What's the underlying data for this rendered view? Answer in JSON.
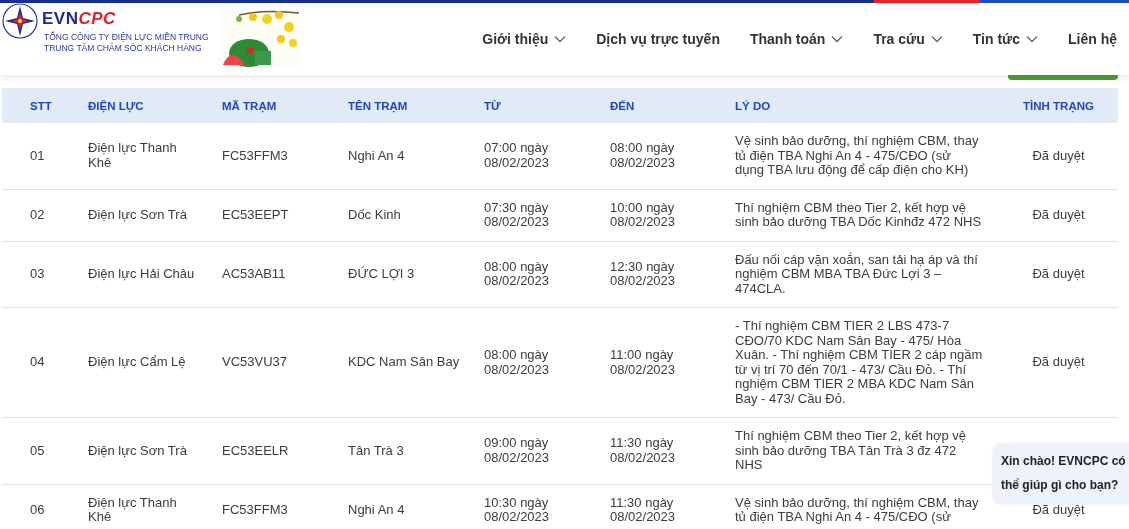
{
  "header": {
    "logo": {
      "brand_primary": "EVN",
      "brand_accent": "CPC",
      "org_lines": [
        "TỔNG CÔNG TY ĐIỆN LỰC MIỀN TRUNG",
        "TRUNG TÂM CHĂM SÓC KHÁCH HÀNG"
      ]
    },
    "nav": [
      {
        "label": "Giới thiệu",
        "has_dropdown": true
      },
      {
        "label": "Dịch vụ trực tuyến",
        "has_dropdown": false
      },
      {
        "label": "Thanh toán",
        "has_dropdown": true
      },
      {
        "label": "Tra cứu",
        "has_dropdown": true
      },
      {
        "label": "Tin tức",
        "has_dropdown": true
      },
      {
        "label": "Liên hệ",
        "has_dropdown": false
      }
    ]
  },
  "table": {
    "columns": [
      "STT",
      "ĐIỆN LỰC",
      "MÃ TRẠM",
      "TÊN TRẠM",
      "TỪ",
      "ĐẾN",
      "LÝ DO",
      "TÌNH TRẠNG"
    ],
    "rows": [
      {
        "stt": "01",
        "unit": "Điện lực Thanh Khê",
        "station_code": "FC53FFM3",
        "station_name": "Nghi An 4",
        "from": "07:00 ngày 08/02/2023",
        "to": "08:00 ngày 08/02/2023",
        "reason": "Vệ sinh bảo dưỡng, thí nghiệm CBM, thay tủ điện TBA Nghi An 4 - 475/CĐO (sử dụng TBA lưu động để cấp điện cho KH)",
        "status": "Đã duyệt"
      },
      {
        "stt": "02",
        "unit": "Điện lực Sơn Trà",
        "station_code": "EC53EEPT",
        "station_name": "Dốc Kinh",
        "from": "07:30 ngày 08/02/2023",
        "to": "10:00 ngày 08/02/2023",
        "reason": "Thí nghiệm CBM theo Tier 2, kết hợp vệ sinh bảo dưỡng TBA Dốc Kinhđz 472 NHS",
        "status": "Đã duyệt"
      },
      {
        "stt": "03",
        "unit": "Điện lực Hải Châu",
        "station_code": "AC53AB11",
        "station_name": "ĐỨC LỢI 3",
        "from": "08:00 ngày 08/02/2023",
        "to": "12:30 ngày 08/02/2023",
        "reason": "Đấu nối cáp vặn xoắn, san tải hạ áp và thí nghiệm CBM MBA TBA Đức Lợi 3 – 474CLA.",
        "status": "Đã duyệt"
      },
      {
        "stt": "04",
        "unit": "Điện lực Cẩm Lệ",
        "station_code": "VC53VU37",
        "station_name": "KDC Nam Sân Bay",
        "from": "08:00 ngày 08/02/2023",
        "to": "11:00 ngày 08/02/2023",
        "reason": "- Thí nghiệm CBM TIER 2 LBS 473-7 CĐO/70 KDC Nam Sân Bay - 475/ Hòa Xuân. - Thí nghiệm CBM TIER 2 cáp ngầm từ vị trí 70 đến 70/1 - 473/ Cầu Đỏ. - Thí nghiệm CBM TIER 2 MBA KDC Nam Sân Bay - 473/ Cầu Đỏ.",
        "status": "Đã duyệt"
      },
      {
        "stt": "05",
        "unit": "Điện lực Sơn Trà",
        "station_code": "EC53EELR",
        "station_name": "Tân Trà 3",
        "from": "09:00 ngày 08/02/2023",
        "to": "11:30 ngày 08/02/2023",
        "reason": "Thí nghiệm CBM theo Tier 2, kết hợp vệ sinh bảo dưỡng TBA Tân Trà 3 đz 472 NHS"
      },
      {
        "stt": "06",
        "unit": "Điện lực Thanh Khê",
        "station_code": "FC53FFM3",
        "station_name": "Nghi An 4",
        "from": "10:30 ngày 08/02/2023",
        "to": "11:30 ngày 08/02/2023",
        "reason": "Vệ sinh bảo dưỡng, thí nghiệm CBM, thay tủ điện TBA Nghi An 4 - 475/CĐO (sử",
        "status": "Đã duyệt"
      }
    ]
  },
  "chat_bubble": {
    "text": "Xin chào! EVNCPC có thể giúp gì cho bạn?"
  }
}
